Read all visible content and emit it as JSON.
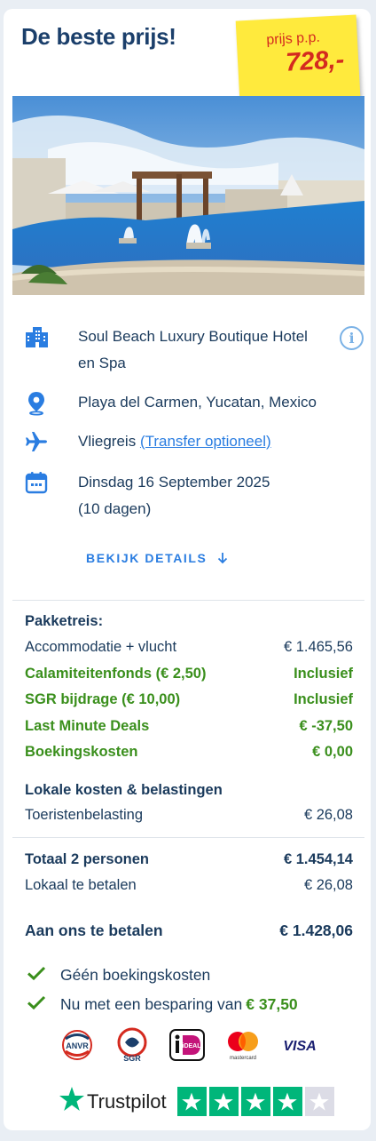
{
  "header": {
    "title": "De beste prijs!",
    "price_label": "prijs p.p.",
    "price": "728,-"
  },
  "hotel": {
    "name": "Soul Beach Luxury Boutique Hotel en Spa",
    "location": "Playa del Carmen, Yucatan, Mexico",
    "travel_type": "Vliegreis",
    "transfer_link": "(Transfer optioneel)",
    "date": "Dinsdag 16 September 2025",
    "duration": "(10 dagen)"
  },
  "details_button": "BEKIJK DETAILS",
  "package": {
    "heading": "Pakketreis:",
    "rows": [
      {
        "label": "Accommodatie + vlucht",
        "value": "€ 1.465,56"
      },
      {
        "label": "Calamiteitenfonds (€ 2,50)",
        "value": "Inclusief"
      },
      {
        "label": "SGR bijdrage (€ 10,00)",
        "value": "Inclusief"
      },
      {
        "label": "Last Minute Deals",
        "value": "€ -37,50"
      },
      {
        "label": "Boekingskosten",
        "value": "€ 0,00"
      }
    ]
  },
  "local": {
    "heading": "Lokale kosten & belastingen",
    "rows": [
      {
        "label": "Toeristenbelasting",
        "value": "€ 26,08"
      }
    ]
  },
  "totals": {
    "total_label": "Totaal 2 personen",
    "total_value": "€ 1.454,14",
    "local_label": "Lokaal te betalen",
    "local_value": "€ 26,08",
    "pay_label": "Aan ons te betalen",
    "pay_value": "€ 1.428,06"
  },
  "benefits": {
    "line1": "Géén boekingskosten",
    "line2_prefix": "Nu met een besparing van",
    "line2_amount": "€ 37,50"
  },
  "payment_logos": {
    "anvr": "ANVR",
    "sgr": "SGR",
    "ideal": "iDEAL",
    "mastercard": "mastercard",
    "visa": "VISA"
  },
  "trustpilot": {
    "label": "Trustpilot",
    "rating": 4,
    "max": 5
  },
  "colors": {
    "accent": "#2a7de1",
    "green": "#3a8f1c",
    "price": "#d42a1f",
    "tag": "#ffea3d",
    "trustpilot": "#00b67a"
  }
}
